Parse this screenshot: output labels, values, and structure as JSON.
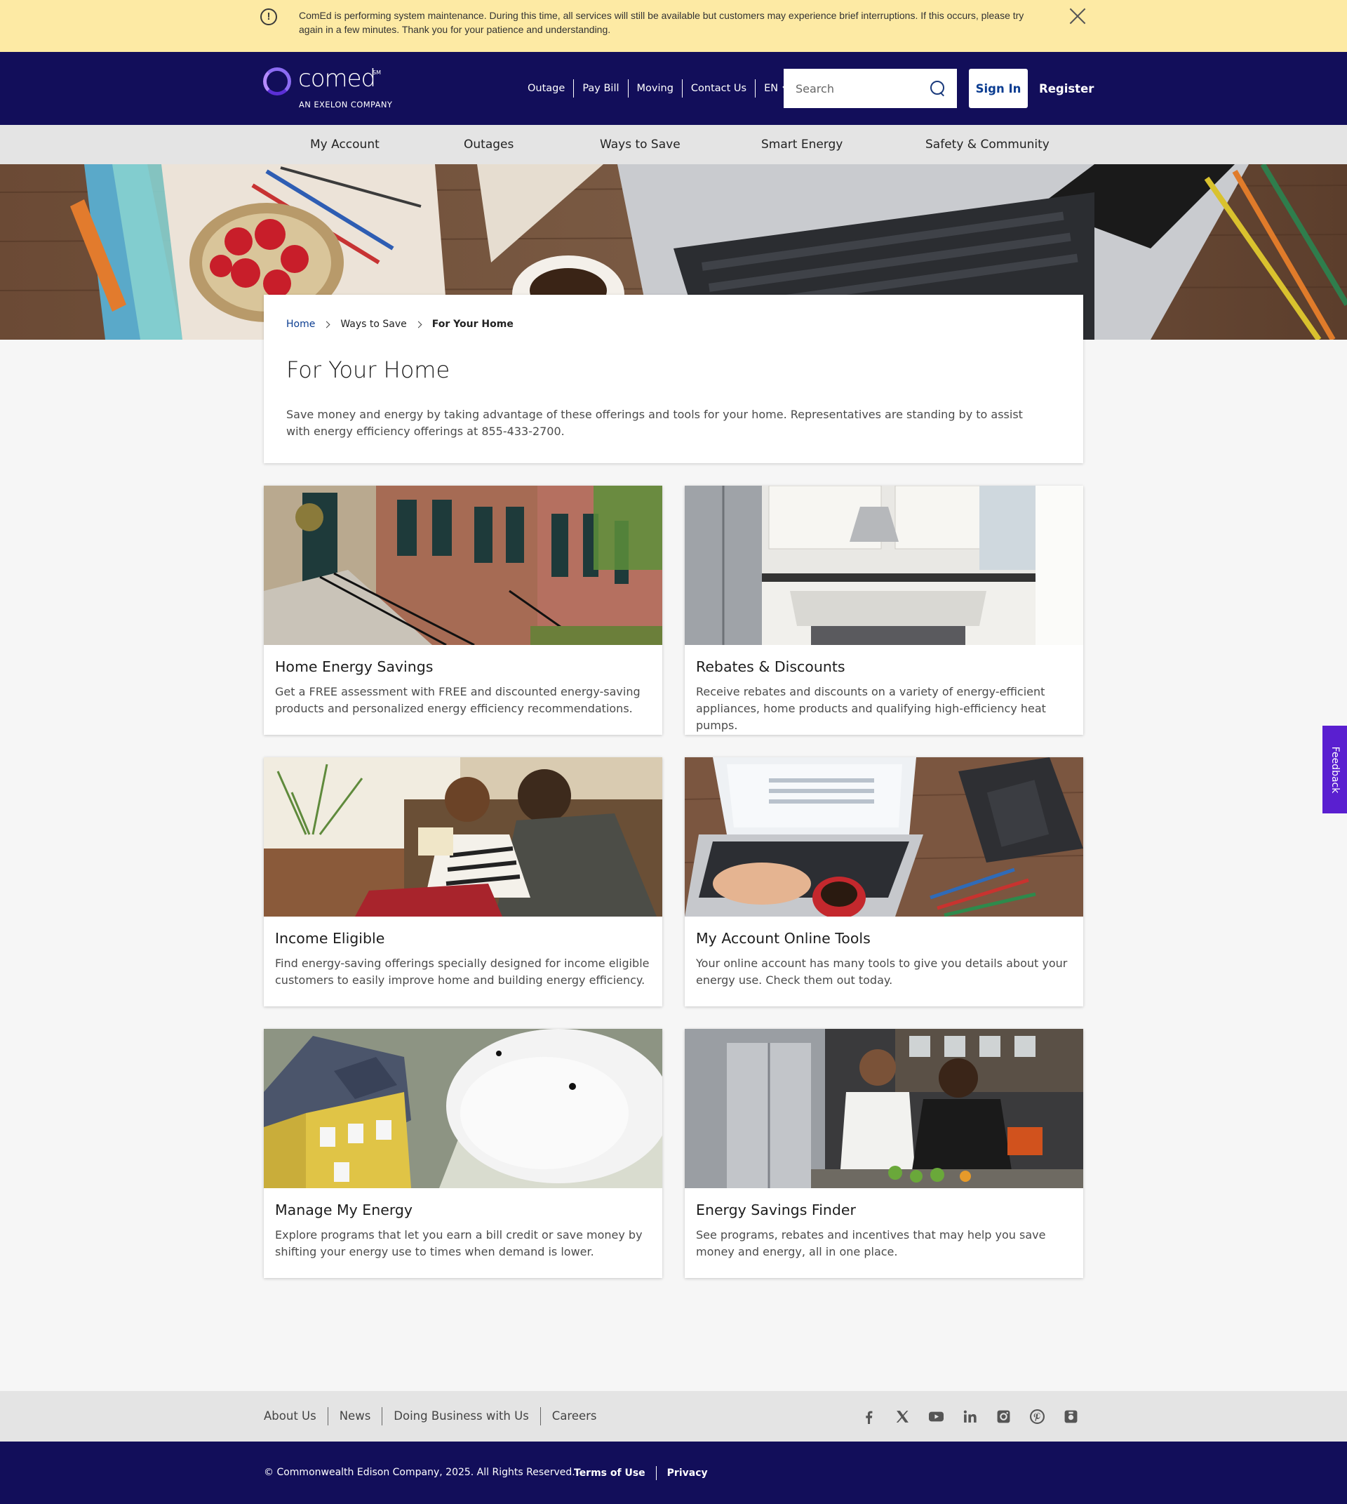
{
  "alert": {
    "message": "ComEd is performing system maintenance. During this time, all services will still be available but customers may experience brief interruptions. If this occurs, please try again in a few minutes. Thank you for your patience  and understanding."
  },
  "header": {
    "logo_word": "comed",
    "logo_tm": "SM",
    "logo_sub": "AN EXELON COMPANY",
    "utility_links": [
      "Outage",
      "Pay Bill",
      "Moving",
      "Contact Us"
    ],
    "language": "EN",
    "search_placeholder": "Search",
    "sign_in": "Sign In",
    "register": "Register"
  },
  "nav": {
    "items": [
      "My Account",
      "Outages",
      "Ways to Save",
      "Smart Energy",
      "Safety & Community"
    ]
  },
  "breadcrumb": {
    "items": [
      "Home",
      "Ways to Save",
      "For Your Home"
    ]
  },
  "page": {
    "title": "For Your Home",
    "intro": "Save money and energy by taking advantage of these offerings and tools for your home. Representatives are standing by to assist with energy efficiency offerings at 855-433-2700."
  },
  "cards": [
    {
      "title": "Home Energy Savings",
      "desc": "Get a FREE assessment with FREE and discounted energy-saving products and personalized energy efficiency recommendations."
    },
    {
      "title": "Rebates & Discounts",
      "desc": "Receive rebates and discounts on a variety of energy-efficient appliances, home products and qualifying high-efficiency heat pumps."
    },
    {
      "title": "Income Eligible",
      "desc": "Find energy-saving offerings specially designed for income eligible customers to easily improve home and building energy efficiency."
    },
    {
      "title": "My Account Online Tools",
      "desc": "Your online account has many tools to give you details about your energy use. Check them out today."
    },
    {
      "title": "Manage My Energy",
      "desc": "Explore programs that let you earn a bill credit or save money by shifting your energy use to times when demand is lower."
    },
    {
      "title": "Energy Savings Finder",
      "desc": "See programs, rebates and incentives that may help you save money and energy, all in one place."
    }
  ],
  "feedback": "Feedback",
  "footer": {
    "links": [
      "About Us",
      "News",
      "Doing Business with Us",
      "Careers"
    ],
    "socials": [
      "facebook-icon",
      "x-icon",
      "youtube-icon",
      "linkedin-icon",
      "instagram-icon",
      "pinterest-icon",
      "flickr-icon"
    ],
    "copyright": "© Commonwealth Edison Company, 2025. All Rights Reserved.",
    "legal": [
      "Terms of Use",
      "Privacy"
    ]
  },
  "colors": {
    "header_bg": "#120e5a",
    "alert_bg": "#fdeaa4",
    "nav_bg": "#e4e4e4",
    "feedback_bg": "#5a1fd0",
    "link_blue": "#0b3d91"
  }
}
